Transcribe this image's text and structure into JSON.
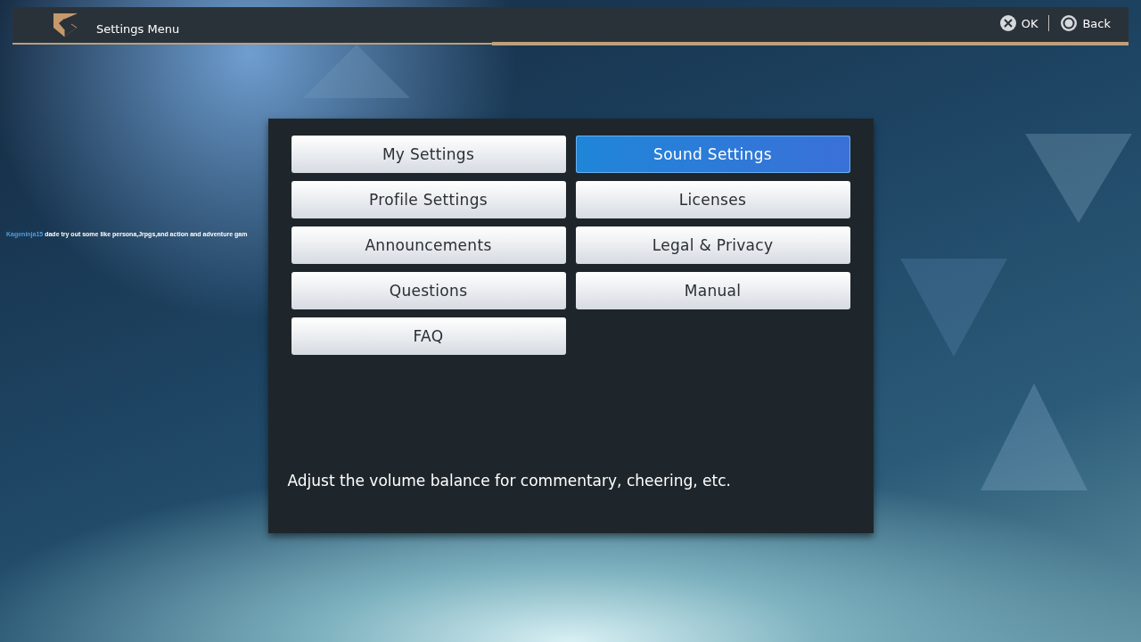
{
  "header": {
    "title": "Settings Menu",
    "actions": [
      {
        "kind": "cross",
        "label": "OK"
      },
      {
        "kind": "circle",
        "label": "Back"
      }
    ]
  },
  "chat_overlay": {
    "user": "Kageninja15",
    "message": "dade try out some like persona,Jrpgs,and action and adventure gam"
  },
  "menu": {
    "items": [
      {
        "label": "My Settings",
        "selected": false
      },
      {
        "label": "Sound Settings",
        "selected": true
      },
      {
        "label": "Profile Settings",
        "selected": false
      },
      {
        "label": "Licenses",
        "selected": false
      },
      {
        "label": "Announcements",
        "selected": false
      },
      {
        "label": "Legal & Privacy",
        "selected": false
      },
      {
        "label": "Questions",
        "selected": false
      },
      {
        "label": "Manual",
        "selected": false
      },
      {
        "label": "FAQ",
        "selected": false
      }
    ],
    "description": "Adjust the volume balance for commentary, cheering, etc."
  }
}
